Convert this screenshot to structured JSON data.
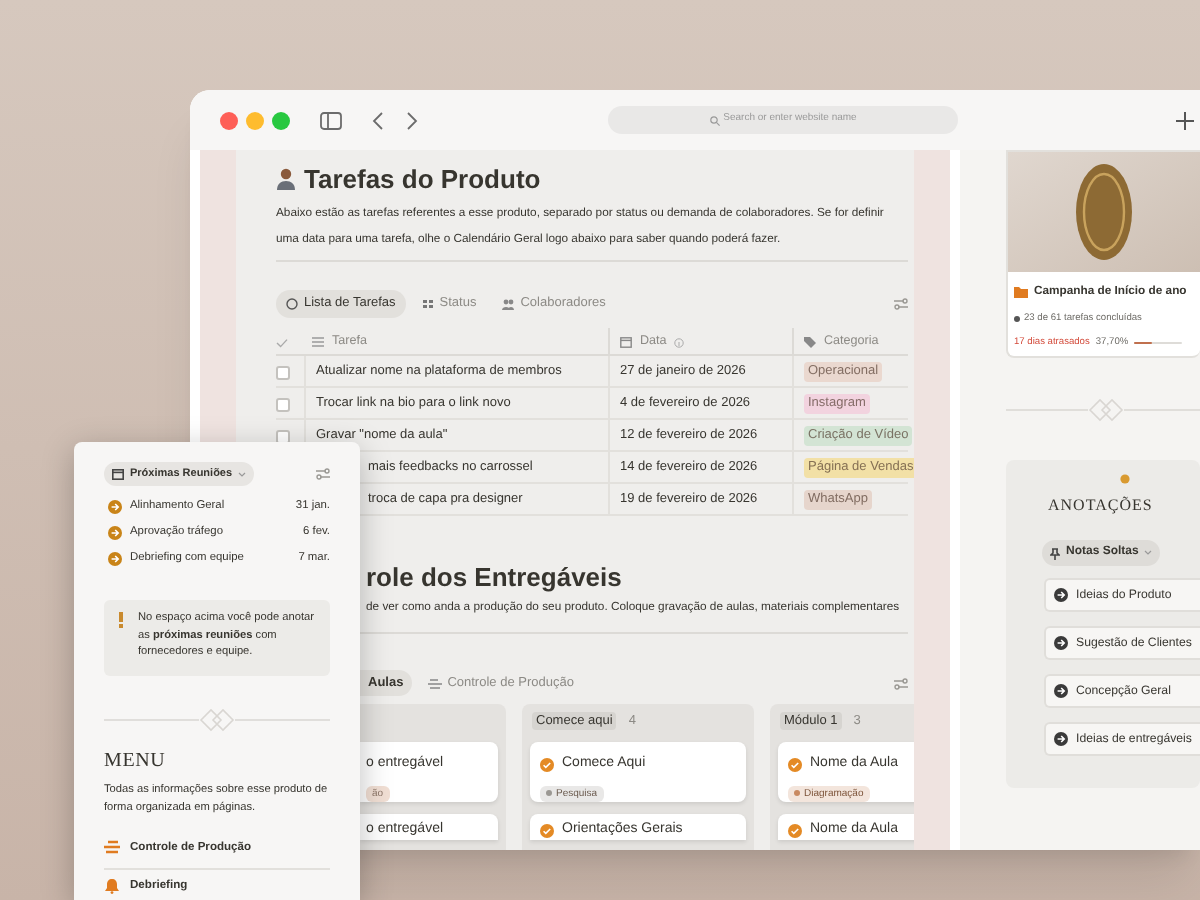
{
  "browser": {
    "address_placeholder": "Search or enter website name"
  },
  "tasks_section": {
    "title": "Tarefas do Produto",
    "description": "Abaixo estão as tarefas referentes a esse produto, separado por status ou demanda de colaboradores. Se for definir uma data para uma tarefa, olhe o Calendário Geral logo abaixo para saber quando poderá fazer.",
    "tabs": [
      {
        "label": "Lista de Tarefas",
        "selected": true
      },
      {
        "label": "Status",
        "selected": false
      },
      {
        "label": "Colaboradores",
        "selected": false
      }
    ],
    "columns": [
      "Tarefa",
      "Data",
      "Categoria"
    ],
    "rows": [
      {
        "checked": false,
        "task": "Atualizar nome na plataforma de membros",
        "date": "27 de janeiro de 2026",
        "category": {
          "label": "Operacional",
          "color": "#ead8cf"
        }
      },
      {
        "checked": false,
        "task": "Trocar link na bio para o link novo",
        "date": "4 de fevereiro de 2026",
        "category": {
          "label": "Instagram",
          "color": "#f2d3df"
        }
      },
      {
        "checked": false,
        "task": "Gravar \"nome da aula\"",
        "date": "12 de fevereiro de 2026",
        "category": {
          "label": "Criação de Vídeo",
          "color": "#d3e4d4"
        }
      },
      {
        "task": "mais feedbacks no carrossel",
        "date": "14 de fevereiro de 2026",
        "category": {
          "label": "Página de Vendas",
          "color": "#f2e0a6"
        }
      },
      {
        "task": "troca de capa pra designer",
        "date": "19 de fevereiro de 2026",
        "category": {
          "label": "WhatsApp",
          "color": "#e6d5cc"
        }
      }
    ]
  },
  "deliverables_section": {
    "title": "role dos Entregáveis",
    "description": "de ver como anda a produção do seu produto. Coloque gravação de aulas, materiais complementares",
    "tabs": [
      {
        "label": "Aulas",
        "selected": true
      },
      {
        "label": "Controle de Produção",
        "selected": false
      }
    ],
    "columns": [
      {
        "cards": [
          {
            "title": "o entregável",
            "tag": {
              "label": "ão",
              "color": "#f1dfd4"
            }
          },
          {
            "title": "o entregável"
          }
        ]
      },
      {
        "name": "Comece aqui",
        "count": "4",
        "cards": [
          {
            "title": "Comece Aqui",
            "tag": {
              "label": "Pesquisa",
              "color": "#9b9893"
            }
          },
          {
            "title": "Orientações Gerais"
          }
        ]
      },
      {
        "name": "Módulo 1",
        "count": "3",
        "cards": [
          {
            "title": "Nome da Aula",
            "tag": {
              "label": "Diagramação",
              "color": "#c98a62"
            }
          },
          {
            "title": "Nome da Aula"
          }
        ]
      }
    ]
  },
  "campaign": {
    "title": "Campanha de Início de ano",
    "progress_text": "23 de 61 tarefas concluídas",
    "overdue": "17 dias atrasados",
    "percent": "37,70%",
    "level": 0.377
  },
  "annotations": {
    "title": "ANOTAÇÕES",
    "filter": "Notas Soltas",
    "items": [
      "Ideias do Produto",
      "Sugestão de Clientes",
      "Concepção Geral",
      "Ideias de entregáveis"
    ]
  },
  "overlay_card": {
    "filter": "Próximas Reuniões",
    "meetings": [
      {
        "name": "Alinhamento Geral",
        "date": "31 jan."
      },
      {
        "name": "Aprovação tráfego",
        "date": "6 fev."
      },
      {
        "name": "Debriefing com equipe",
        "date": "7 mar."
      }
    ],
    "callout": "No espaço acima você pode anotar as **próximas reuniões** com fornecedores e equipe.",
    "menu_title": "MENU",
    "menu_description": "Todas as informações sobre esse produto de forma organizada em páginas.",
    "links": [
      "Controle de Produção",
      "Debriefing"
    ]
  }
}
